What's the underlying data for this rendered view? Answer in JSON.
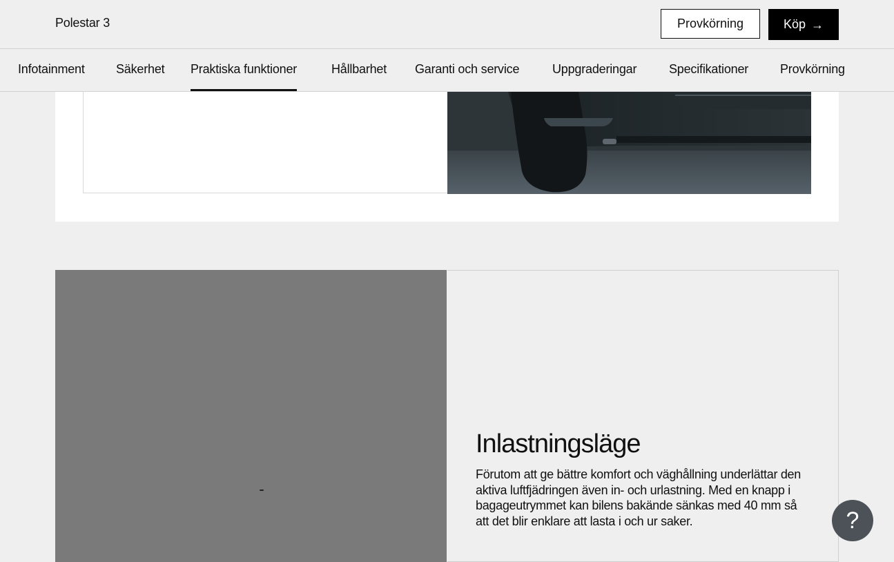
{
  "header": {
    "brand": "Polestar 3",
    "test_drive_label": "Provkörning",
    "buy_label": "Köp",
    "buy_icon": "arrow-right-icon"
  },
  "tabs": [
    {
      "label": "Infotainment",
      "active": false
    },
    {
      "label": "Säkerhet",
      "active": false
    },
    {
      "label": "Praktiska funktioner",
      "active": true
    },
    {
      "label": "Hållbarhet",
      "active": false
    },
    {
      "label": "Garanti och service",
      "active": false
    },
    {
      "label": "Uppgraderingar",
      "active": false
    },
    {
      "label": "Specifikationer",
      "active": false
    },
    {
      "label": "Provkörning",
      "active": false
    }
  ],
  "feature": {
    "title": "Inlastningsläge",
    "body": "Förutom att ge bättre komfort och väghållning underlättar den aktiva luftfjädringen även in- och urlastning. Med en knapp i bagageutrymmet kan bilens bakände sänkas med 40 mm så att det blir enklare att lasta i och ur saker."
  },
  "help": {
    "label": "?"
  },
  "colors": {
    "background": "#efefef",
    "accent": "#000000",
    "help_button": "#4c5257",
    "media_placeholder": "#7a7a7a"
  }
}
